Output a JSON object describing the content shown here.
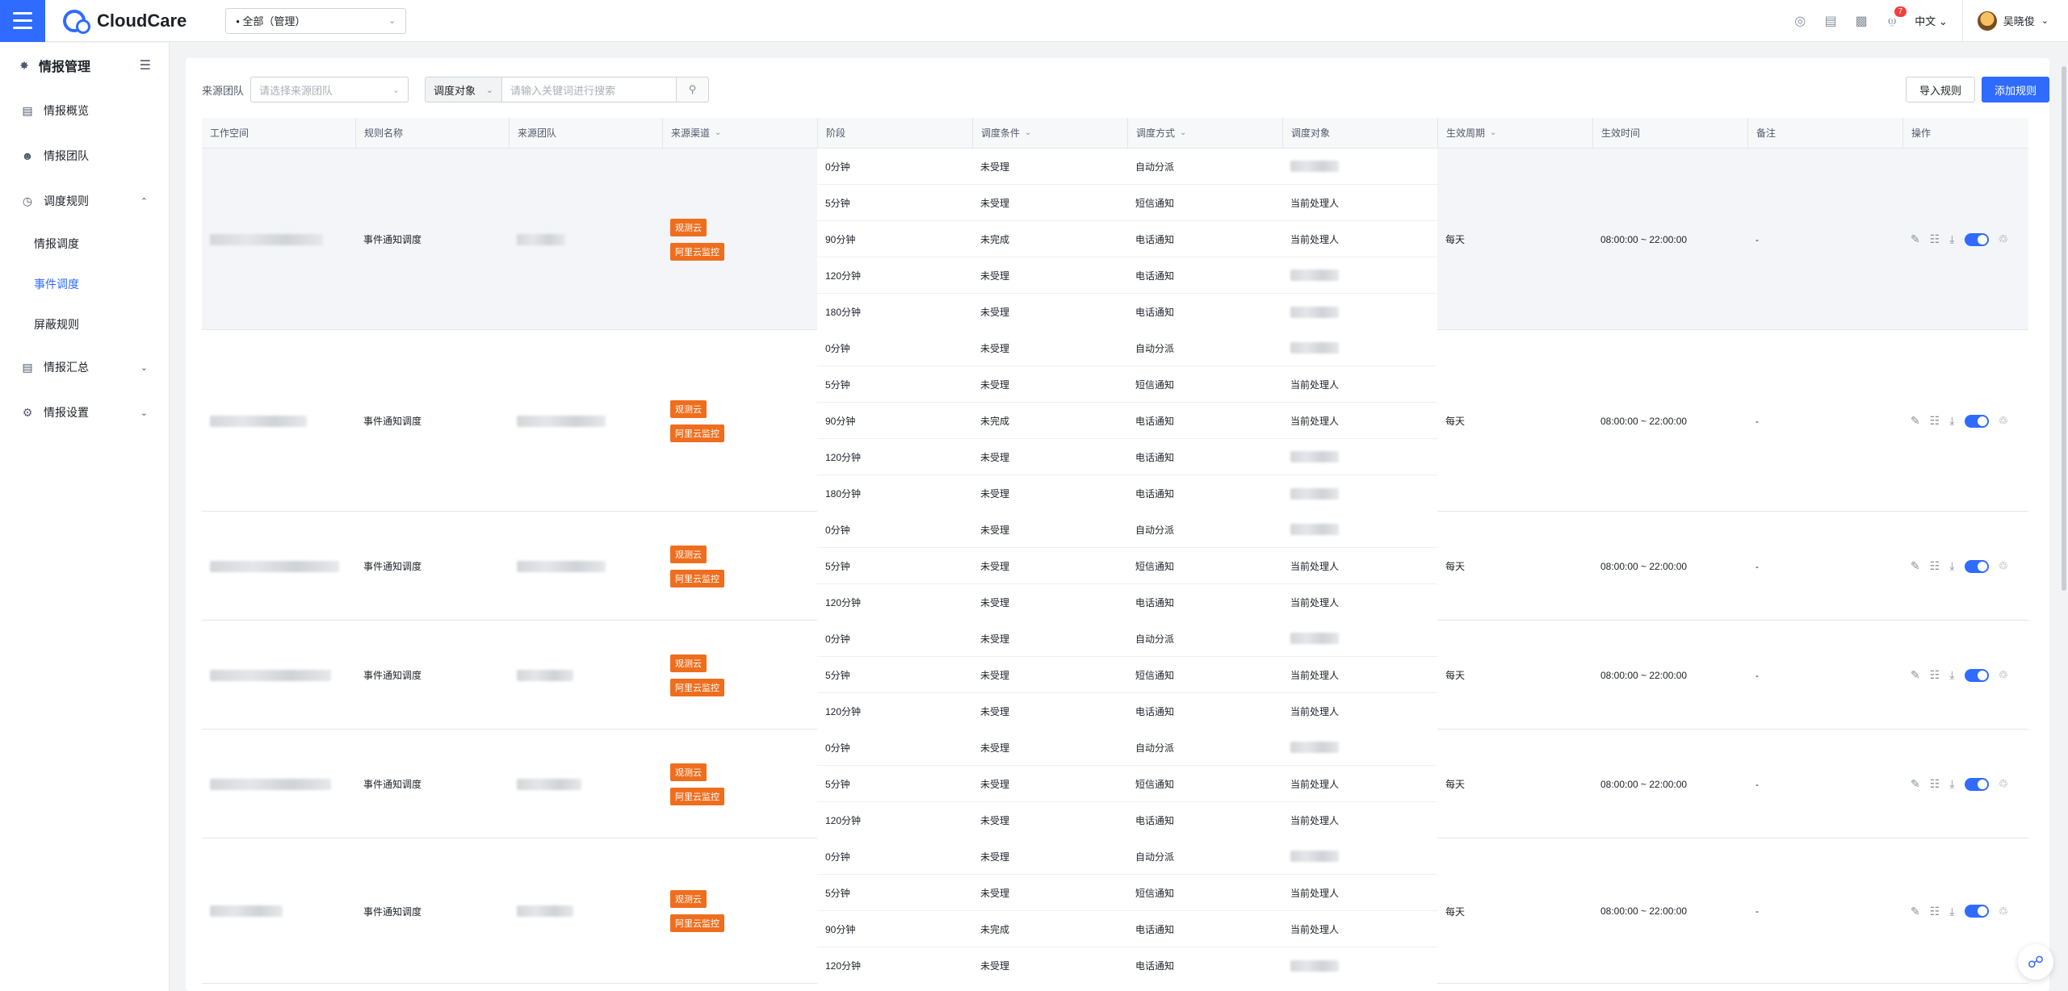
{
  "topbar": {
    "brand": "CloudCare",
    "workspace": "• 全部（管理）",
    "notification_count": "7",
    "language": "中文",
    "username": "吴晓俊"
  },
  "sidebar": {
    "title": "情报管理",
    "items": [
      {
        "label": "情报概览",
        "icon": "overview-icon"
      },
      {
        "label": "情报团队",
        "icon": "team-icon"
      },
      {
        "label": "调度规则",
        "icon": "schedule-icon",
        "expanded": true,
        "children": [
          {
            "label": "情报调度",
            "active": false
          },
          {
            "label": "事件调度",
            "active": true
          },
          {
            "label": "屏蔽规则",
            "active": false
          }
        ]
      },
      {
        "label": "情报汇总",
        "icon": "summary-icon"
      },
      {
        "label": "情报设置",
        "icon": "settings-icon"
      }
    ]
  },
  "filters": {
    "source_team_label": "来源团队",
    "source_team_placeholder": "请选择来源团队",
    "search_prefix": "调度对象",
    "search_placeholder": "请输入关键词进行搜索"
  },
  "actions": {
    "import": "导入规则",
    "add": "添加规则"
  },
  "table": {
    "headers": [
      "工作空间",
      "规则名称",
      "来源团队",
      "来源渠道",
      "阶段",
      "调度条件",
      "调度方式",
      "调度对象",
      "生效周期",
      "生效时间",
      "备注",
      "操作"
    ],
    "rows": [
      {
        "rule_name": "事件通知调度",
        "channels": [
          "观测云",
          "阿里云监控"
        ],
        "period": "每天",
        "time": "08:00:00 ~ 22:00:00",
        "note": "-",
        "stages": [
          {
            "stage": "0分钟",
            "cond": "未受理",
            "method": "自动分派",
            "target": ""
          },
          {
            "stage": "5分钟",
            "cond": "未受理",
            "method": "短信通知",
            "target": "当前处理人"
          },
          {
            "stage": "90分钟",
            "cond": "未完成",
            "method": "电话通知",
            "target": "当前处理人"
          },
          {
            "stage": "120分钟",
            "cond": "未受理",
            "method": "电话通知",
            "target": ""
          },
          {
            "stage": "180分钟",
            "cond": "未受理",
            "method": "电话通知",
            "target": ""
          }
        ]
      },
      {
        "rule_name": "事件通知调度",
        "channels": [
          "观测云",
          "阿里云监控"
        ],
        "period": "每天",
        "time": "08:00:00 ~ 22:00:00",
        "note": "-",
        "stages": [
          {
            "stage": "0分钟",
            "cond": "未受理",
            "method": "自动分派",
            "target": ""
          },
          {
            "stage": "5分钟",
            "cond": "未受理",
            "method": "短信通知",
            "target": "当前处理人"
          },
          {
            "stage": "90分钟",
            "cond": "未完成",
            "method": "电话通知",
            "target": "当前处理人"
          },
          {
            "stage": "120分钟",
            "cond": "未受理",
            "method": "电话通知",
            "target": ""
          },
          {
            "stage": "180分钟",
            "cond": "未受理",
            "method": "电话通知",
            "target": ""
          }
        ]
      },
      {
        "rule_name": "事件通知调度",
        "channels": [
          "观测云",
          "阿里云监控"
        ],
        "period": "每天",
        "time": "08:00:00 ~ 22:00:00",
        "note": "-",
        "stages": [
          {
            "stage": "0分钟",
            "cond": "未受理",
            "method": "自动分派",
            "target": ""
          },
          {
            "stage": "5分钟",
            "cond": "未受理",
            "method": "短信通知",
            "target": "当前处理人"
          },
          {
            "stage": "120分钟",
            "cond": "未受理",
            "method": "电话通知",
            "target": "当前处理人"
          }
        ]
      },
      {
        "rule_name": "事件通知调度",
        "channels": [
          "观测云",
          "阿里云监控"
        ],
        "period": "每天",
        "time": "08:00:00 ~ 22:00:00",
        "note": "-",
        "stages": [
          {
            "stage": "0分钟",
            "cond": "未受理",
            "method": "自动分派",
            "target": ""
          },
          {
            "stage": "5分钟",
            "cond": "未受理",
            "method": "短信通知",
            "target": "当前处理人"
          },
          {
            "stage": "120分钟",
            "cond": "未受理",
            "method": "电话通知",
            "target": "当前处理人"
          }
        ]
      },
      {
        "rule_name": "事件通知调度",
        "channels": [
          "观测云",
          "阿里云监控"
        ],
        "period": "每天",
        "time": "08:00:00 ~ 22:00:00",
        "note": "-",
        "stages": [
          {
            "stage": "0分钟",
            "cond": "未受理",
            "method": "自动分派",
            "target": ""
          },
          {
            "stage": "5分钟",
            "cond": "未受理",
            "method": "短信通知",
            "target": "当前处理人"
          },
          {
            "stage": "120分钟",
            "cond": "未受理",
            "method": "电话通知",
            "target": "当前处理人"
          }
        ]
      },
      {
        "rule_name": "事件通知调度",
        "channels": [
          "观测云",
          "阿里云监控"
        ],
        "period": "每天",
        "time": "08:00:00 ~ 22:00:00",
        "note": "-",
        "stages": [
          {
            "stage": "0分钟",
            "cond": "未受理",
            "method": "自动分派",
            "target": ""
          },
          {
            "stage": "5分钟",
            "cond": "未受理",
            "method": "短信通知",
            "target": "当前处理人"
          },
          {
            "stage": "90分钟",
            "cond": "未完成",
            "method": "电话通知",
            "target": "当前处理人"
          },
          {
            "stage": "120分钟",
            "cond": "未受理",
            "method": "电话通知",
            "target": ""
          }
        ]
      }
    ]
  }
}
